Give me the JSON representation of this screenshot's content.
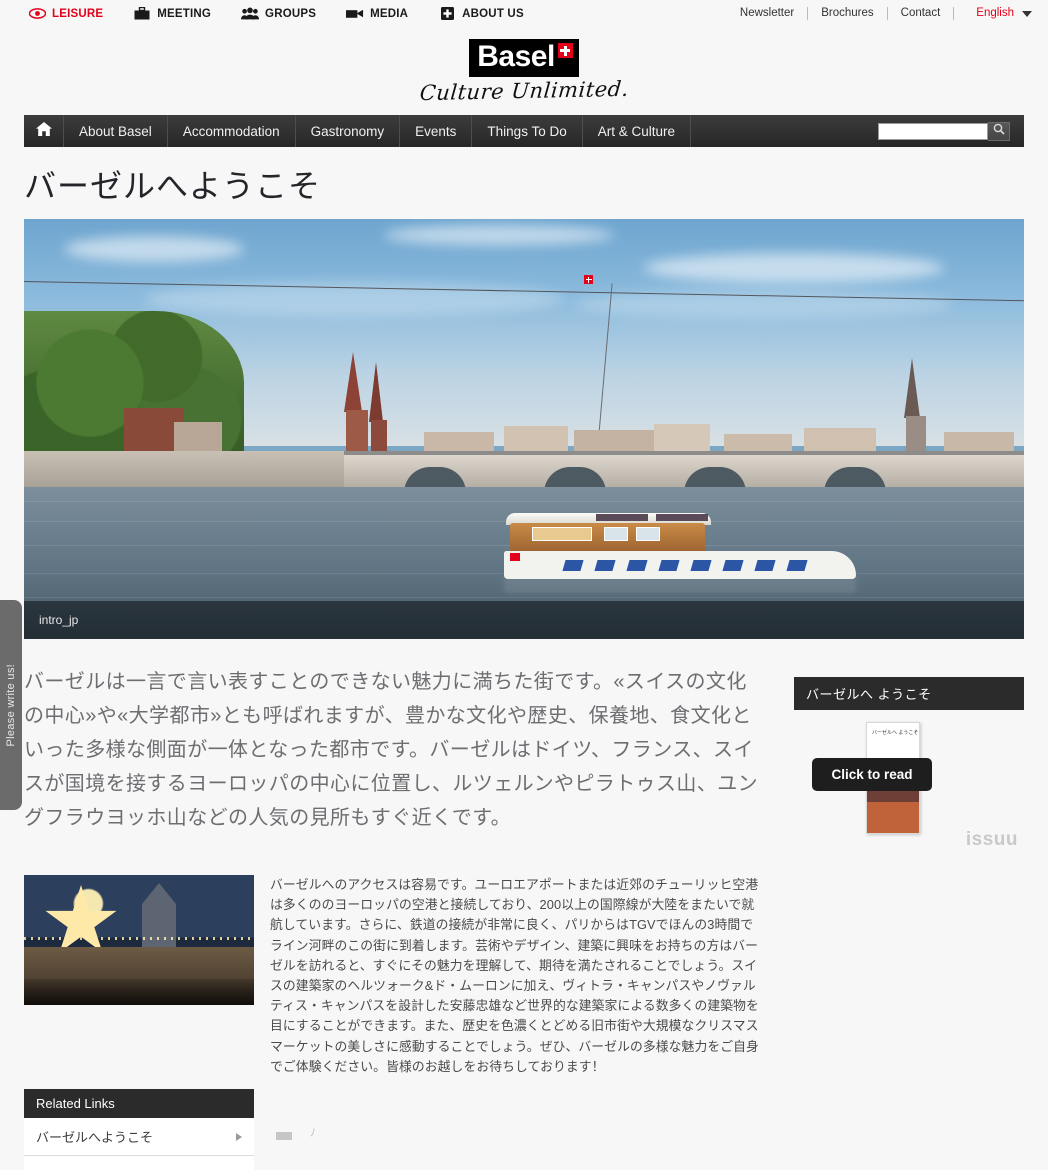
{
  "topnav": {
    "items": [
      {
        "label": "LEISURE",
        "icon": "eye-icon",
        "active": true
      },
      {
        "label": "MEETING",
        "icon": "briefcase-icon",
        "active": false
      },
      {
        "label": "GROUPS",
        "icon": "people-icon",
        "active": false
      },
      {
        "label": "MEDIA",
        "icon": "video-camera-icon",
        "active": false
      },
      {
        "label": "ABOUT US",
        "icon": "plus-box-icon",
        "active": false
      }
    ],
    "links": [
      {
        "label": "Newsletter"
      },
      {
        "label": "Brochures"
      },
      {
        "label": "Contact"
      }
    ],
    "language": "English"
  },
  "logo": {
    "word": "Basel",
    "tagline": "Culture Unlimited."
  },
  "mainnav": {
    "home_icon": "home-icon",
    "items": [
      {
        "label": "About Basel"
      },
      {
        "label": "Accommodation"
      },
      {
        "label": "Gastronomy"
      },
      {
        "label": "Events"
      },
      {
        "label": "Things To Do"
      },
      {
        "label": "Art & Culture"
      }
    ],
    "search": {
      "value": "",
      "placeholder": "",
      "icon": "search-icon"
    }
  },
  "page": {
    "title": "バーゼルへようこそ"
  },
  "hero": {
    "caption": "intro_jp",
    "alt": "Rhine river with passenger boat and Basel old town skyline"
  },
  "lead": "バーゼルは一言で言い表すことのできない魅力に満ちた街です。«スイスの文化の中心»や«大学都市»とも呼ばれますが、豊かな文化や歴史、保養地、食文化といった多様な側面が一体となった都市です。バーゼルはドイツ、フランス、スイスが国境を接するヨーロッパの中心に位置し、ルツェルンやピラトゥス山、ユングフラウヨッホ山などの人気の見所もすぐ近くです。",
  "sidebar": {
    "header": "バーゼルへ ようこそ",
    "brochure_title": "バーゼルへ\nようこそ",
    "click_to_read": "Click to read",
    "brand": "issuu"
  },
  "lower": {
    "photo_alt": "Basel Christmas market with illuminated star",
    "body": "バーゼルへのアクセスは容易です。ユーロエアポートまたは近郊のチューリッヒ空港は多くののヨーロッパの空港と接続しており、200以上の国際線が大陸をまたいで就航しています。さらに、鉄道の接続が非常に良く、パリからはTGVでほんの3時間でライン河畔のこの街に到着します。芸術やデザイン、建築に興味をお持ちの方はバーゼルを訪れると、すぐにその魅力を理解して、期待を満たされることでしょう。スイスの建築家のヘルツォーク&ド・ムーロンに加え、ヴィトラ・キャンパスやノヴァルティス・キャンパスを設計した安藤忠雄など世界的な建築家による数多くの建築物を目にすることができます。また、歴史を色濃くとどめる旧市街や大規模なクリスマスマーケットの美しさに感動することでしょう。ぜひ、バーゼルの多様な魅力をご自身でご体験ください。皆様のお越しをお待ちしております！"
  },
  "related": {
    "header": "Related Links",
    "items": [
      {
        "label": "バーゼルへようこそ"
      }
    ]
  },
  "feedback": {
    "label": "Please write us!"
  },
  "colors": {
    "accent_red": "#e2001a",
    "nav_dark": "#2b2b2b",
    "page_bg": "#f7f7f7",
    "lead_text": "#6d6e71"
  }
}
